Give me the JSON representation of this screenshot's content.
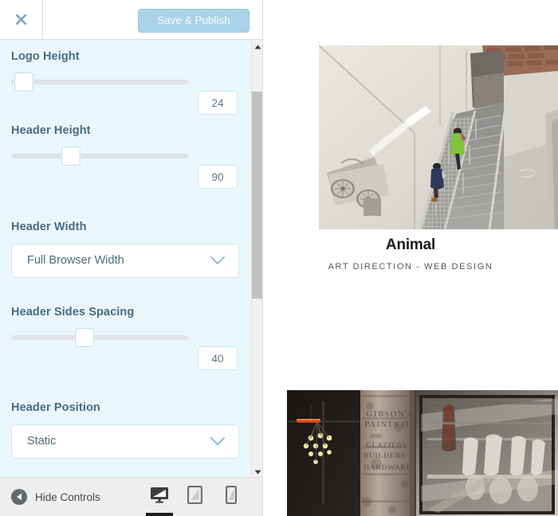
{
  "customizer": {
    "header": {
      "close_icon": "close-x-icon",
      "save_label": "Save & Publish",
      "save_disabled": true
    },
    "controls": [
      {
        "type": "slider",
        "label": "Logo Height",
        "value": "24",
        "thumb_percent": 2
      },
      {
        "type": "slider",
        "label": "Header Height",
        "value": "90",
        "thumb_percent": 28
      },
      {
        "type": "select",
        "label": "Header Width",
        "value": "Full Browser Width",
        "chevron_icon": "chevron-down-icon"
      },
      {
        "type": "slider",
        "label": "Header Sides Spacing",
        "value": "40",
        "thumb_percent": 36
      },
      {
        "type": "select",
        "label": "Header Position",
        "value": "Static",
        "chevron_icon": "chevron-down-icon"
      }
    ],
    "scrollbar": {
      "up_icon": "caret-up-icon",
      "down_icon": "caret-down-icon"
    },
    "footer": {
      "hide_controls_label": "Hide Controls",
      "hide_controls_icon": "caret-left-circle-icon",
      "devices": [
        {
          "name": "desktop",
          "icon": "desktop-icon",
          "active": true
        },
        {
          "name": "tablet",
          "icon": "tablet-icon",
          "active": false
        },
        {
          "name": "mobile",
          "icon": "mobile-icon",
          "active": false
        }
      ]
    }
  },
  "preview": {
    "project": {
      "title": "Animal",
      "subtitle": "ART DIRECTION  -  WEB DESIGN"
    },
    "images": [
      {
        "alt": "aerial-view-of-people-on-metal-staircase"
      },
      {
        "alt": "storefront-window-with-weathered-brick-column"
      }
    ]
  },
  "colors": {
    "panel_bg": "#e9f6fb",
    "label": "#4a6c7e",
    "accent": "#a9d4e8",
    "footer_bg": "#eeeeee",
    "active_underline": "#1e1e1e"
  }
}
